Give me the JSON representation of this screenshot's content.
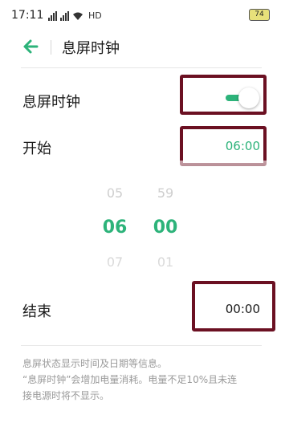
{
  "status_bar": {
    "time": "17:11",
    "network": "HD",
    "battery": "74"
  },
  "header": {
    "title": "息屏时钟",
    "back_icon": "back-arrow-icon"
  },
  "settings": {
    "clock_toggle": {
      "label": "息屏时钟",
      "enabled": true
    },
    "start": {
      "label": "开始",
      "value": "06:00"
    },
    "end": {
      "label": "结束",
      "value": "00:00"
    }
  },
  "picker": {
    "hour": {
      "above": "05",
      "selected": "06",
      "below": "07"
    },
    "minute": {
      "above": "59",
      "selected": "00",
      "below": "01"
    }
  },
  "footer": {
    "line1": "息屏状态显示时间及日期等信息。",
    "line2": "“息屏时钟”会增加电量消耗。电量不足10%且未连",
    "line3": "接电源时将不显示。"
  },
  "colors": {
    "accent": "#2db37a",
    "highlight_border": "#6b1022"
  }
}
